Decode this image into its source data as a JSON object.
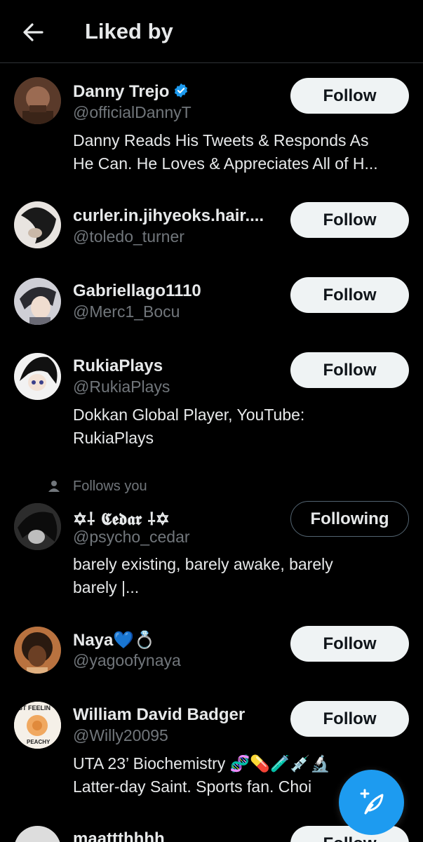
{
  "header": {
    "title": "Liked by"
  },
  "users": [
    {
      "name": "Danny Trejo",
      "handle": "@officialDannyT",
      "verified": true,
      "bio_line1": "Danny Reads His Tweets & Responds As",
      "bio_line2": "He Can. He Loves & Appreciates All of H...",
      "button": "Follow"
    },
    {
      "name": "curler.in.jihyeoks.hair....",
      "handle": "@toledo_turner",
      "button": "Follow"
    },
    {
      "name": "Gabriellago1110",
      "handle": "@Merc1_Bocu",
      "button": "Follow"
    },
    {
      "name": "RukiaPlays",
      "handle": "@RukiaPlays",
      "bio_line1": "Dokkan Global Player, YouTube:",
      "bio_line2": "RukiaPlays",
      "button": "Follow"
    },
    {
      "follows_you": "Follows you",
      "name": "✡︎⸸ 𝕮𝖊𝖉𝖆𝖗 ⸸✡︎",
      "handle": "@psycho_cedar",
      "bio_line1": "barely existing, barely awake, barely",
      "bio_line2": "barely |...",
      "button": "Following"
    },
    {
      "name": "Naya💙💍",
      "handle": "@yagoofynaya",
      "button": "Follow"
    },
    {
      "name": "William David Badger",
      "handle": "@Willy20095",
      "bio_line1": "UTA 23’ Biochemistry 🧬💊🧪💉🔬",
      "bio_line2": "Latter-day Saint. Sports fan. Choi",
      "avatar_text_top": "ST FEELIN",
      "avatar_text_bottom": "PEACHY",
      "button": "Follow"
    },
    {
      "name": "maattthhhh",
      "button": "Follow"
    }
  ],
  "colors": {
    "accent": "#1d9bf0",
    "background": "#000000",
    "muted": "#71767b"
  },
  "icons": {
    "back": "arrow-left-icon",
    "verified": "verified-badge-icon",
    "fab": "compose-feather-icon",
    "follows_you": "person-icon"
  }
}
